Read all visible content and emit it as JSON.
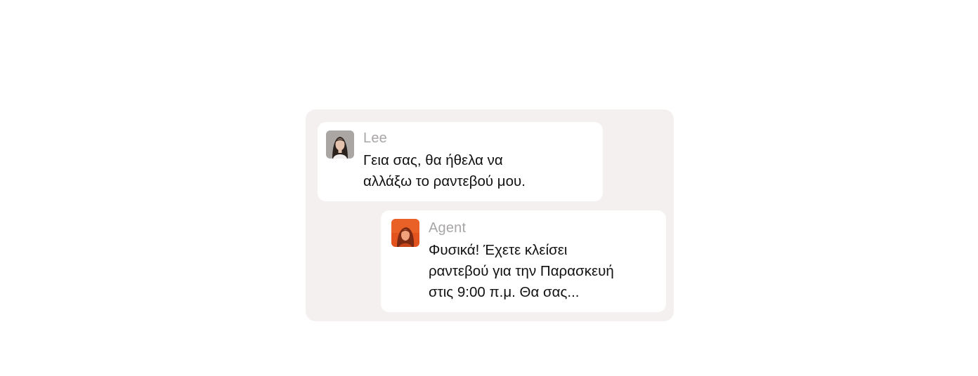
{
  "chat": {
    "messages": [
      {
        "sender": "Lee",
        "avatar_icon": "woman-portrait-avatar-icon",
        "text": "Γεια σας, θα ήθελα να\nαλλάξω το ραντεβού μου."
      },
      {
        "sender": "Agent",
        "avatar_icon": "agent-portrait-avatar-icon",
        "avatar_color": "#e2531e",
        "text": "Φυσικά! Έχετε κλείσει\nραντεβού για την Παρασκευή\nστις 9:00 π.μ. Θα σας..."
      }
    ]
  },
  "colors": {
    "panel_background": "#f4f0ef",
    "bubble_background": "#ffffff",
    "sender_text": "#a9a6a6",
    "message_text": "#111111"
  }
}
